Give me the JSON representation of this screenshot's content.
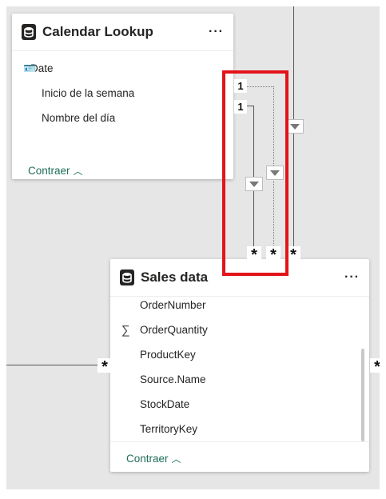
{
  "calendar_table": {
    "title": "Calendar Lookup",
    "more_label": "···",
    "fields": [
      {
        "name": "Date",
        "icon": "calendar-hierarchy-icon"
      },
      {
        "name": "Inicio de la semana",
        "icon": ""
      },
      {
        "name": "Nombre del día",
        "icon": ""
      }
    ],
    "collapse_label": "Contraer"
  },
  "sales_table": {
    "title": "Sales data",
    "more_label": "···",
    "fields": [
      {
        "name": "OrderNumber",
        "icon": ""
      },
      {
        "name": "OrderQuantity",
        "icon": "sigma-icon"
      },
      {
        "name": "ProductKey",
        "icon": ""
      },
      {
        "name": "Source.Name",
        "icon": ""
      },
      {
        "name": "StockDate",
        "icon": ""
      },
      {
        "name": "TerritoryKey",
        "icon": ""
      }
    ],
    "collapse_label": "Contraer"
  },
  "relationships": {
    "one_label": "1",
    "many_label": "*"
  },
  "colors": {
    "highlight": "#e3131a",
    "collapse_link": "#1e6e58",
    "canvas": "#e6e6e6"
  }
}
